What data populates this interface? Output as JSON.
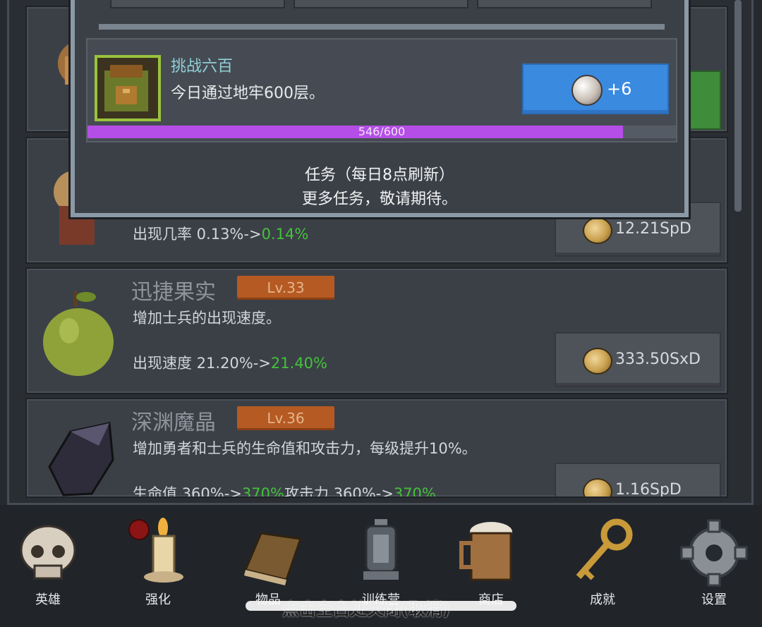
{
  "popup": {
    "quest": {
      "title": "挑战六百",
      "description": "今日通过地牢600层。",
      "reward_amount": "+6",
      "progress_text": "546/600",
      "progress": 0.91
    },
    "info_line1": "任务（每日8点刷新）",
    "info_line2": "更多任务，敬请期待。"
  },
  "cards": [
    {
      "stat_label": "出现几率 0.13%->",
      "stat_new": "0.14%",
      "price": "12.21SpD"
    },
    {
      "name": "迅捷果实",
      "level": "Lv.33",
      "description": "增加士兵的出现速度。",
      "stat_label": "出现速度 21.20%->",
      "stat_new": "21.40%",
      "price": "333.50SxD"
    },
    {
      "name": "深渊魔晶",
      "level": "Lv.36",
      "description": "增加勇者和士兵的生命值和攻击力，每级提升10%。",
      "stat_label_a": "生命值 360%->",
      "stat_new_a": "370%",
      "stat_label_b": "攻击力 360%->",
      "stat_new_b": "370%",
      "price": "1.16SpD"
    }
  ],
  "nav": [
    {
      "label": "英雄",
      "icon": "skull-icon"
    },
    {
      "label": "强化",
      "icon": "candle-icon",
      "badge": true
    },
    {
      "label": "物品",
      "icon": "book-icon"
    },
    {
      "label": "训练营",
      "icon": "lantern-icon"
    },
    {
      "label": "商店",
      "icon": "mug-icon"
    },
    {
      "label": "成就",
      "icon": "key-icon"
    },
    {
      "label": "设置",
      "icon": "gear-icon"
    }
  ],
  "hint": "点击空白处关闭(取消)"
}
